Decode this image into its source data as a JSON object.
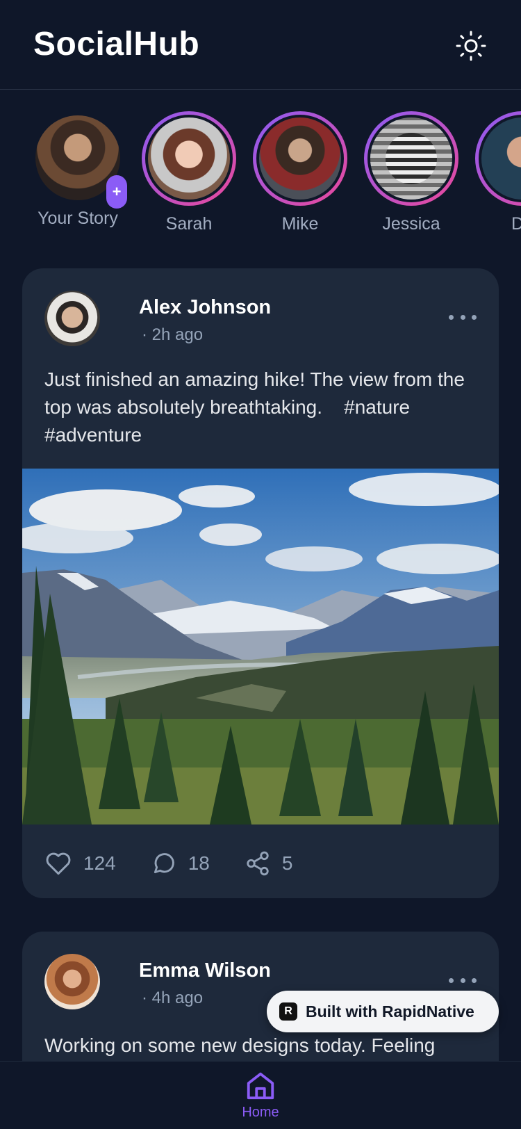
{
  "header": {
    "title": "SocialHub",
    "theme_icon": "sun-icon"
  },
  "stories": [
    {
      "name": "Your Story",
      "own": true
    },
    {
      "name": "Sarah"
    },
    {
      "name": "Mike"
    },
    {
      "name": "Jessica"
    },
    {
      "name": "Da"
    }
  ],
  "posts": [
    {
      "author": "Alex Johnson",
      "time": "· 2h ago",
      "text": "Just finished an amazing hike! The view from the top was absolutely breathtaking.    #nature #adventure",
      "likes": "124",
      "comments": "18",
      "shares": "5"
    },
    {
      "author": "Emma Wilson",
      "time": "· 4h ago",
      "text": "Working on some new designs today. Feeling"
    }
  ],
  "badge": {
    "label": "Built with RapidNative"
  },
  "nav": {
    "home_label": "Home"
  },
  "colors": {
    "background": "#0f1729",
    "card": "#1e293b",
    "accent": "#8b5cf6",
    "story_ring_end": "#ec4899",
    "muted_text": "#94a3b8"
  }
}
